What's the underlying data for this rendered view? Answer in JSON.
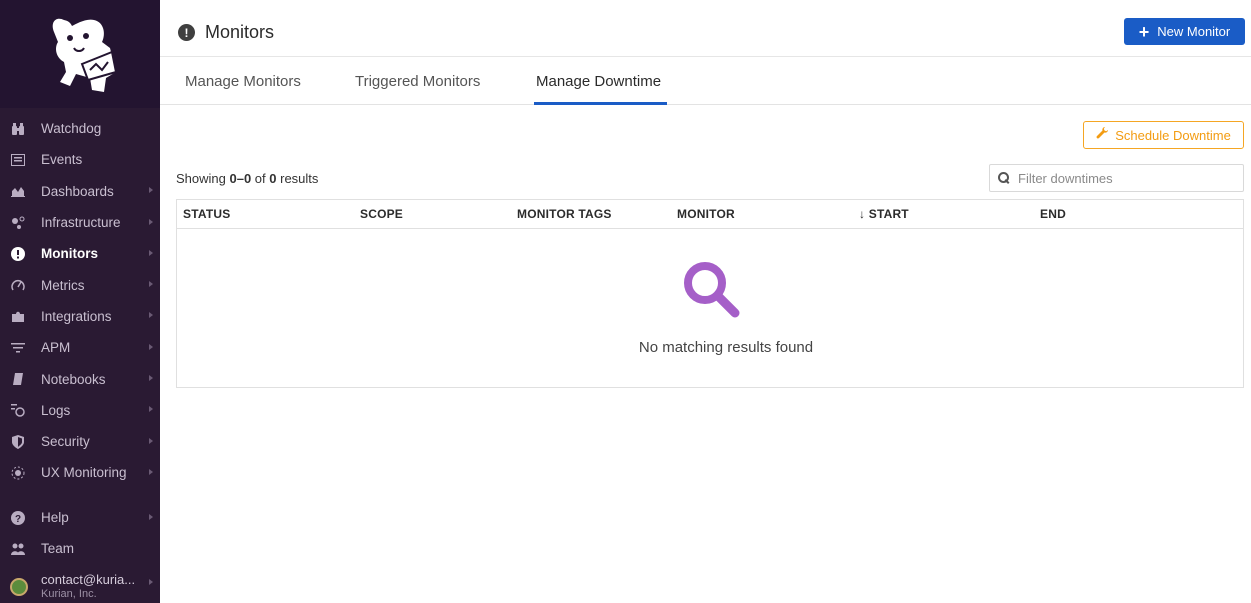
{
  "header": {
    "title": "Monitors",
    "new_monitor_label": "New Monitor",
    "accent_color": "#1a5cc6"
  },
  "sidebar": {
    "background": "#2a1a33",
    "items": [
      {
        "label": "Watchdog",
        "icon": "binoculars-icon"
      },
      {
        "label": "Events",
        "icon": "events-icon"
      },
      {
        "label": "Dashboards",
        "icon": "dashboards-icon"
      },
      {
        "label": "Infrastructure",
        "icon": "infrastructure-icon"
      },
      {
        "label": "Monitors",
        "icon": "alert-icon",
        "active": true
      },
      {
        "label": "Metrics",
        "icon": "metrics-icon"
      },
      {
        "label": "Integrations",
        "icon": "puzzle-icon"
      },
      {
        "label": "APM",
        "icon": "apm-icon"
      },
      {
        "label": "Notebooks",
        "icon": "notebook-icon"
      },
      {
        "label": "Logs",
        "icon": "logs-icon"
      },
      {
        "label": "Security",
        "icon": "shield-icon"
      },
      {
        "label": "UX Monitoring",
        "icon": "ux-monitoring-icon"
      }
    ],
    "bottom": {
      "help": "Help",
      "team": "Team",
      "user_email": "contact@kuria...",
      "user_org": "Kurian, Inc."
    }
  },
  "tabs": [
    {
      "label": "Manage Monitors"
    },
    {
      "label": "Triggered Monitors"
    },
    {
      "label": "Manage Downtime",
      "active": true
    }
  ],
  "main": {
    "schedule_label": "Schedule Downtime",
    "schedule_color": "#f39c12",
    "showing_prefix": "Showing ",
    "showing_range": "0–0",
    "showing_of": " of ",
    "showing_total": "0",
    "showing_suffix": " results",
    "filter_placeholder": "Filter downtimes",
    "columns": [
      "STATUS",
      "SCOPE",
      "MONITOR TAGS",
      "MONITOR",
      "↓ START",
      "END"
    ],
    "empty_text": "No matching results found",
    "empty_icon_color": "#a55fc8"
  }
}
